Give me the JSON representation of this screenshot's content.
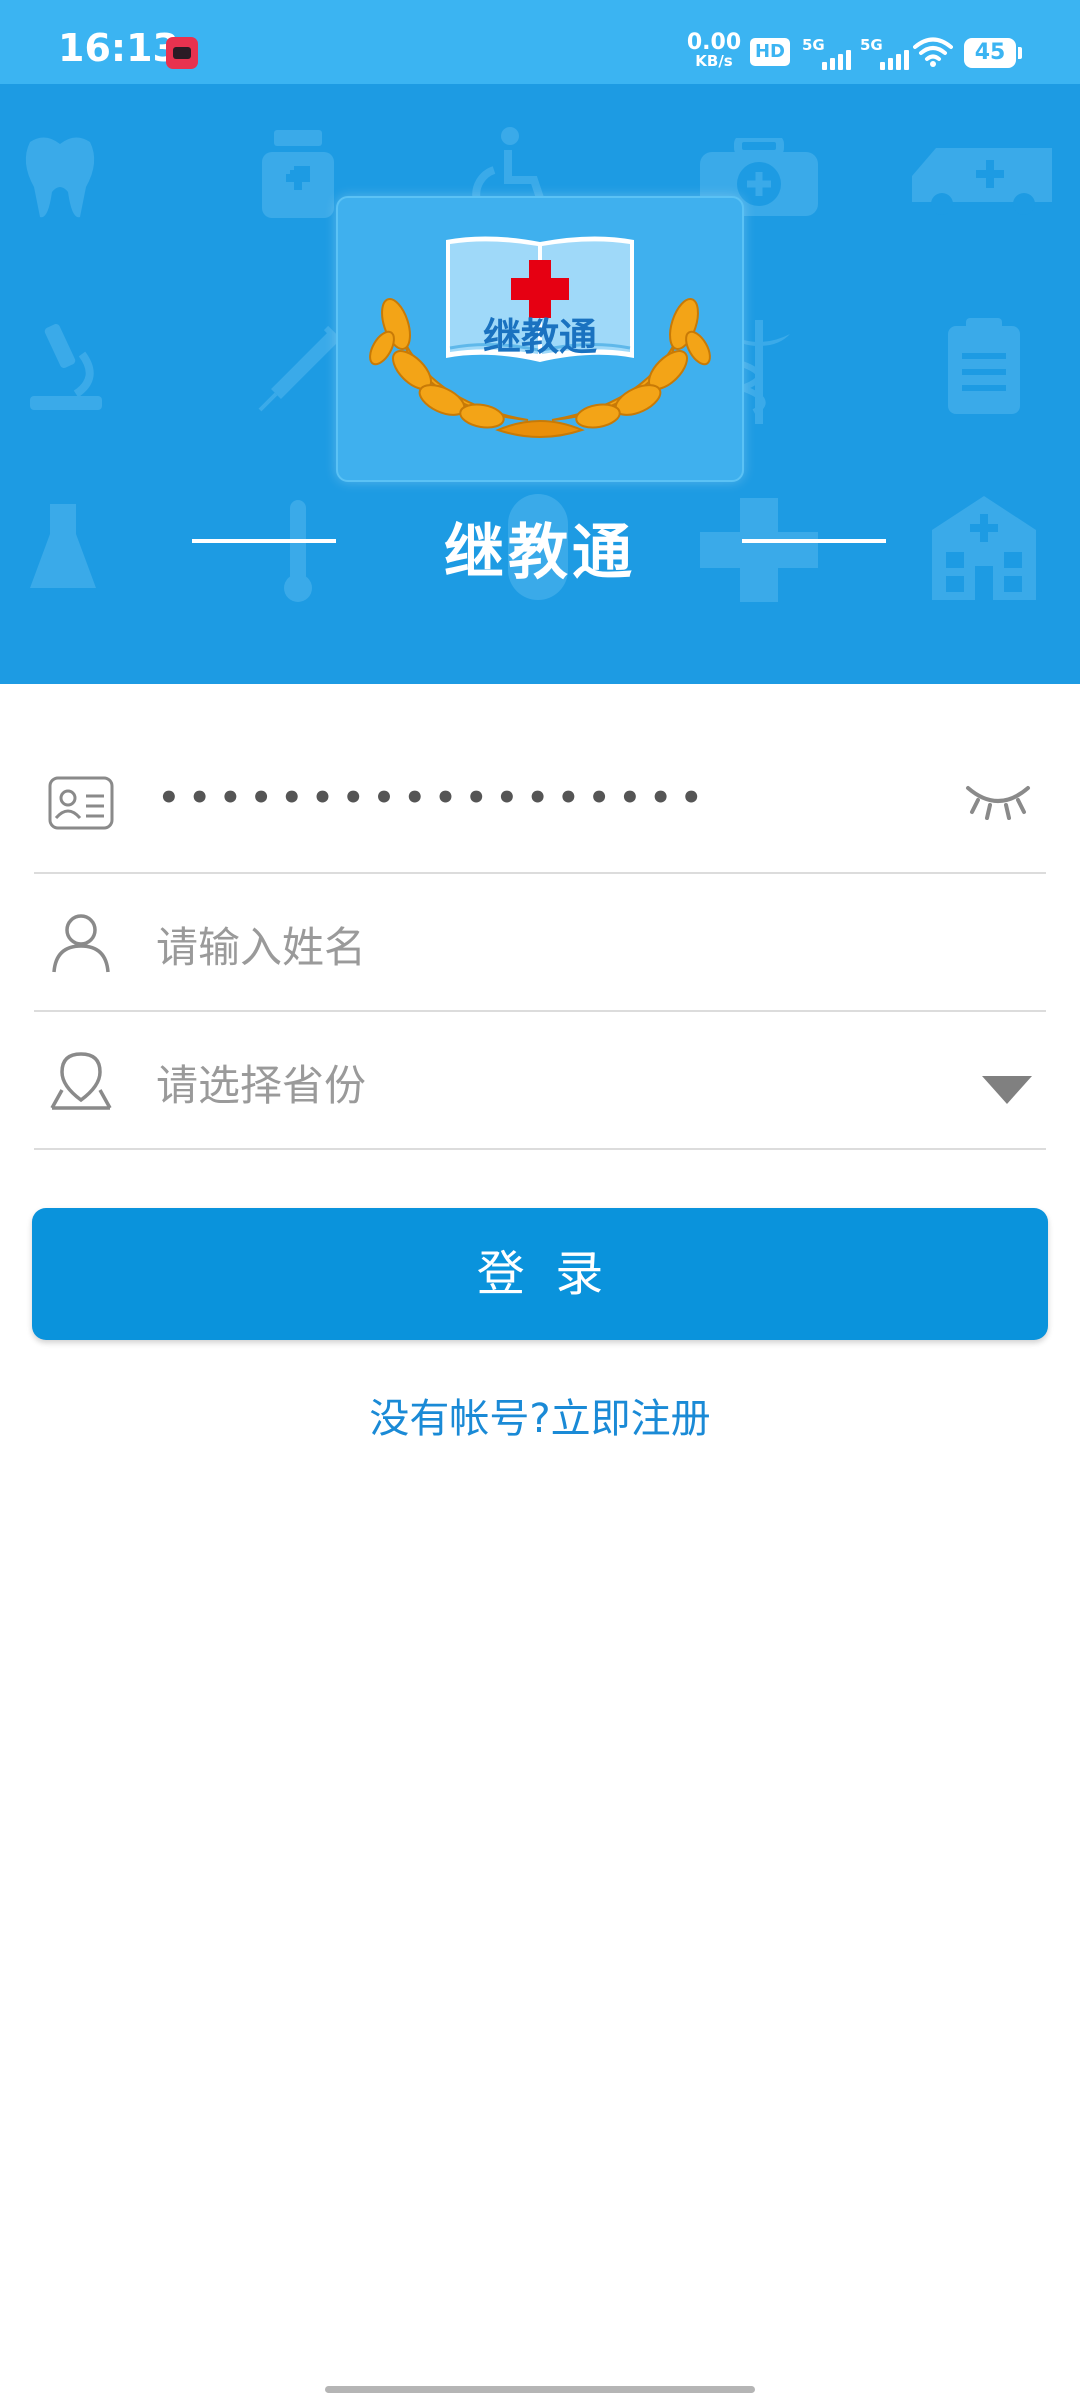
{
  "status_bar": {
    "time": "16:13",
    "net_speed": "0.00",
    "net_unit": "KB/s",
    "hd_badge": "HD",
    "sim1_label": "5G",
    "sim2_label": "5G",
    "battery": "45"
  },
  "header": {
    "logo_text": "继教通",
    "title": "继教通"
  },
  "form": {
    "id_field": {
      "value_masked": "••••••••••••••••••",
      "icon": "id-card-icon",
      "toggle_icon": "eye-closed-icon"
    },
    "name_field": {
      "placeholder": "请输入姓名",
      "icon": "person-icon"
    },
    "province_field": {
      "placeholder": "请选择省份",
      "icon": "location-icon",
      "dropdown_icon": "triangle-down-icon"
    }
  },
  "login_button_label": "登  录",
  "register_link": "没有帐号?立即注册",
  "colors": {
    "status_bar": "#3bb4f2",
    "banner": "#1d9be3",
    "button": "#0a93dc",
    "link": "#1a8ad6"
  }
}
